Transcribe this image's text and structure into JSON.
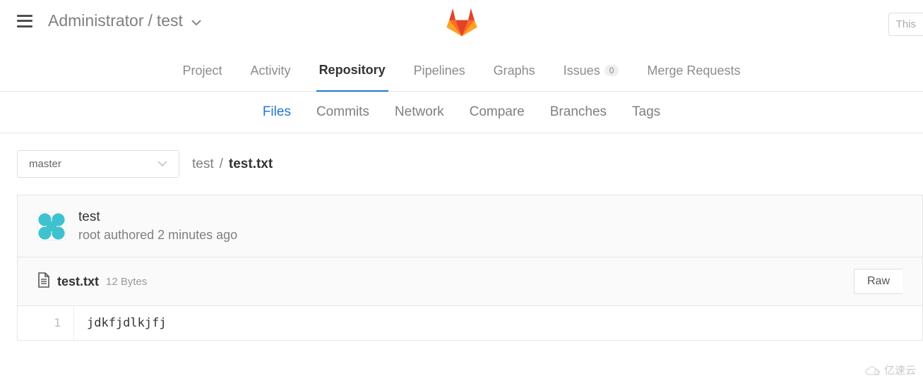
{
  "header": {
    "owner": "Administrator",
    "project": "test",
    "search_placeholder": "This"
  },
  "nav": {
    "items": [
      {
        "label": "Project"
      },
      {
        "label": "Activity"
      },
      {
        "label": "Repository",
        "active": true
      },
      {
        "label": "Pipelines"
      },
      {
        "label": "Graphs"
      },
      {
        "label": "Issues",
        "badge": "0"
      },
      {
        "label": "Merge Requests"
      }
    ]
  },
  "subnav": {
    "items": [
      {
        "label": "Files",
        "active": true
      },
      {
        "label": "Commits"
      },
      {
        "label": "Network"
      },
      {
        "label": "Compare"
      },
      {
        "label": "Branches"
      },
      {
        "label": "Tags"
      }
    ]
  },
  "branch": {
    "selected": "master"
  },
  "path": {
    "root": "test",
    "current": "test.txt"
  },
  "commit": {
    "title": "test",
    "author": "root",
    "verb": "authored",
    "time": "2 minutes ago"
  },
  "file": {
    "name": "test.txt",
    "size": "12 Bytes",
    "raw_label": "Raw",
    "line_number": "1",
    "content": "jdkfjdlkjfj"
  },
  "watermark": "亿速云"
}
